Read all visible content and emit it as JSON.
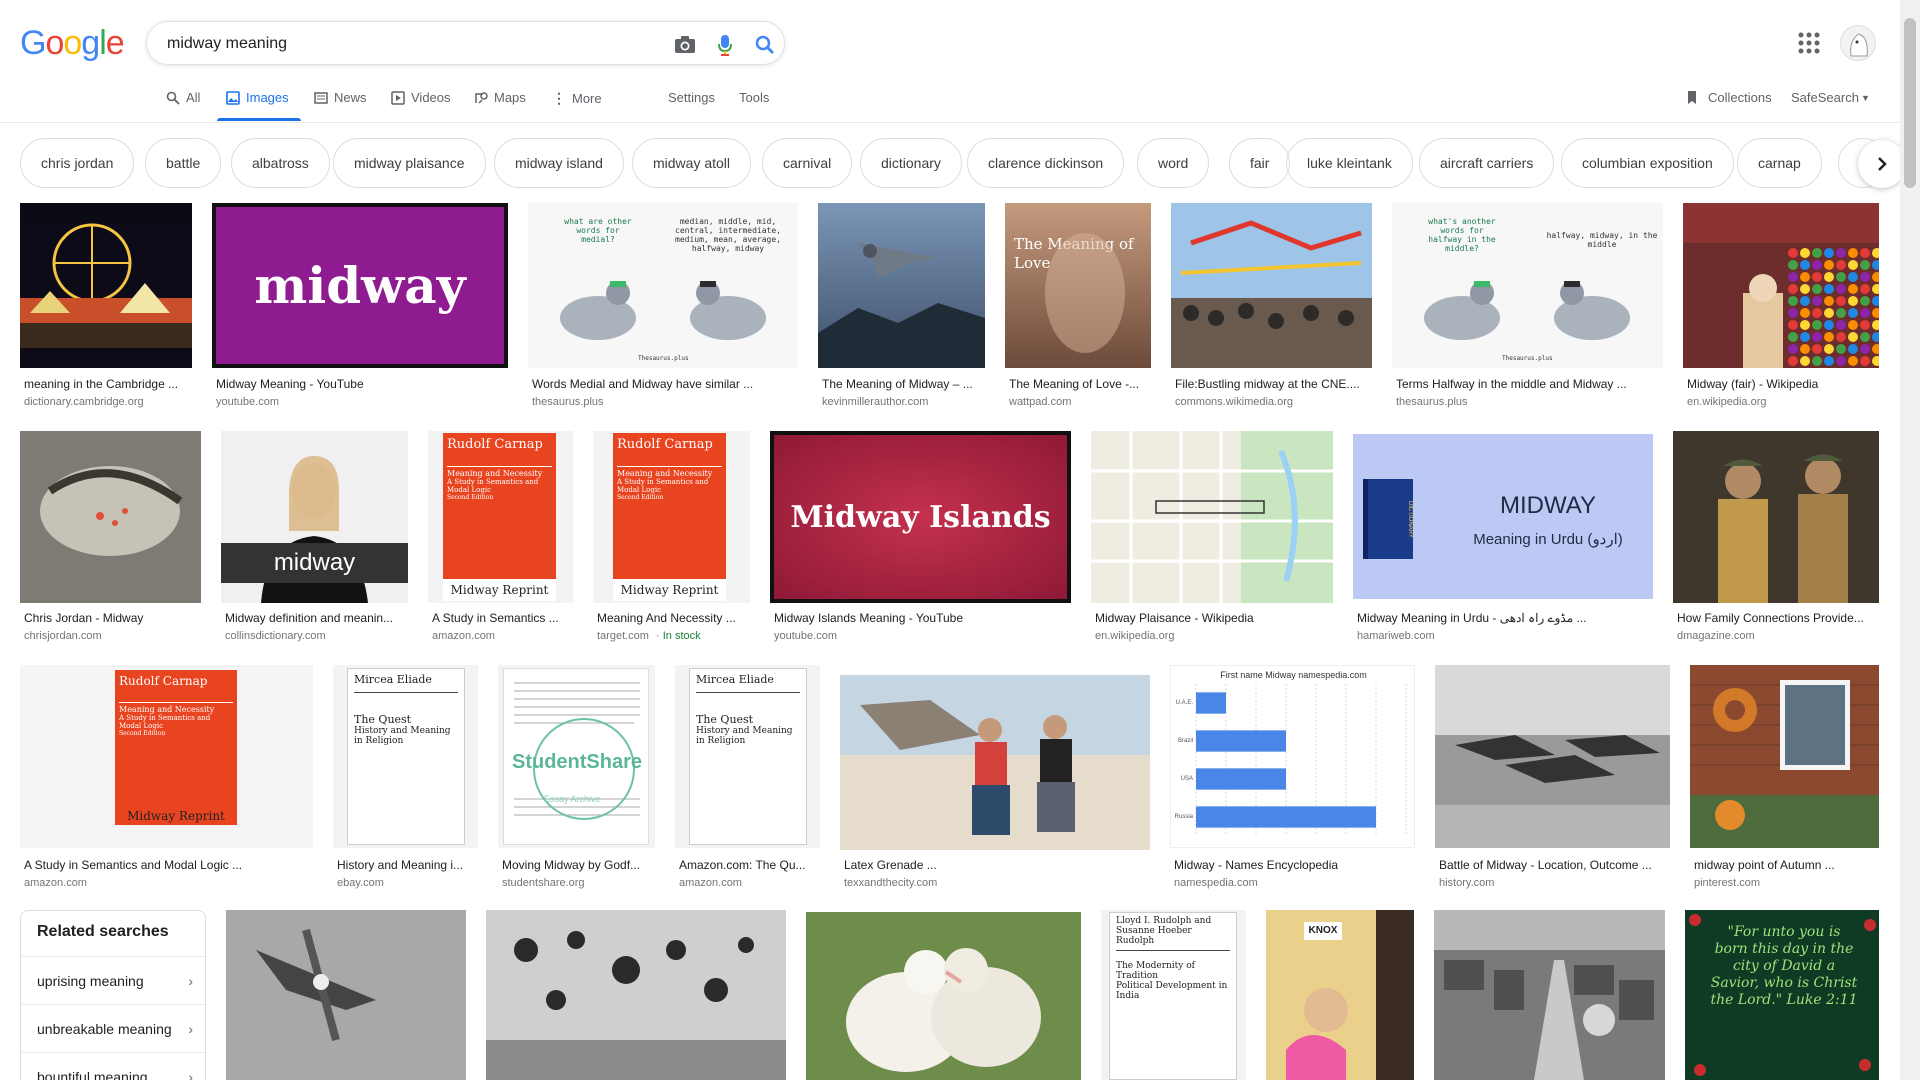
{
  "header": {
    "logo_letters": [
      "G",
      "o",
      "o",
      "g",
      "l",
      "e"
    ],
    "logo_colors": [
      "#4285f4",
      "#ea4335",
      "#fbbc05",
      "#4285f4",
      "#34a853",
      "#ea4335"
    ],
    "search_value": "midway meaning",
    "icons": {
      "camera": "camera-icon",
      "mic": "microphone-icon",
      "search": "search-icon",
      "apps": "apps-grid-icon"
    }
  },
  "tabs": {
    "all": "All",
    "images": "Images",
    "news": "News",
    "videos": "Videos",
    "maps": "Maps",
    "more": "More",
    "settings": "Settings",
    "tools": "Tools",
    "collections": "Collections",
    "safesearch": "SafeSearch"
  },
  "chips": [
    "chris jordan",
    "battle",
    "albatross",
    "midway plaisance",
    "midway island",
    "midway atoll",
    "carnival",
    "dictionary",
    "clarence dickinson",
    "word",
    "fair",
    "luke kleintank",
    "aircraft carriers",
    "columbian exposition",
    "carnap",
    "e"
  ],
  "results": {
    "row1": [
      {
        "caption": "meaning in the Cambridge ...",
        "source": "dictionary.cambridge.org"
      },
      {
        "caption": "Midway Meaning - YouTube",
        "source": "youtube.com",
        "image_text": "midway"
      },
      {
        "caption": "Words Medial and Midway have similar ...",
        "source": "thesaurus.plus",
        "image_text_left": "what are other words for medial?",
        "image_text_right": "median, middle, mid, central, intermediate, medium, mean, average, halfway, midway",
        "image_footer": "Thesaurus.plus"
      },
      {
        "caption": "The Meaning of Midway – ...",
        "source": "kevinmillerauthor.com"
      },
      {
        "caption": "The Meaning of Love -...",
        "source": "wattpad.com",
        "image_text": "The Meaning of Love"
      },
      {
        "caption": "File:Bustling midway at the CNE....",
        "source": "commons.wikimedia.org"
      },
      {
        "caption": "Terms Halfway in the middle and Midway ...",
        "source": "thesaurus.plus",
        "image_text_left": "what's another words for halfway in the middle?",
        "image_text_right": "halfway, midway, in the middle",
        "image_footer": "Thesaurus.plus"
      },
      {
        "caption": "Midway (fair) - Wikipedia",
        "source": "en.wikipedia.org"
      }
    ],
    "row2": [
      {
        "caption": "Chris Jordan - Midway",
        "source": "chrisjordan.com"
      },
      {
        "caption": "Midway definition and meanin...",
        "source": "collinsdictionary.com",
        "image_text": "midway"
      },
      {
        "caption": "A Study in Semantics ...",
        "source": "amazon.com",
        "image_author": "Rudolf Carnap",
        "image_title": "Meaning and Necessity",
        "image_sub": "A Study in Semantics and Modal Logic",
        "image_ed": "Second Edition",
        "image_footer": "Midway Reprint"
      },
      {
        "caption": "Meaning And Necessity ...",
        "source": "target.com",
        "stock": "In stock",
        "image_author": "Rudolf Carnap",
        "image_title": "Meaning and Necessity",
        "image_sub": "A Study in Semantics and Modal Logic",
        "image_ed": "Second Edition",
        "image_footer": "Midway Reprint"
      },
      {
        "caption": "Midway Islands Meaning - YouTube",
        "source": "youtube.com",
        "image_text": "Midway Islands"
      },
      {
        "caption": "Midway Plaisance - Wikipedia",
        "source": "en.wikipedia.org"
      },
      {
        "caption": "Midway Meaning in Urdu - مڈوے راہ ادھی ...",
        "source": "hamariweb.com",
        "image_title": "MIDWAY",
        "image_sub": "Meaning in Urdu (اردو)",
        "image_book": "DICTIONARY"
      },
      {
        "caption": "How Family Connections Provide...",
        "source": "dmagazine.com"
      }
    ],
    "row3": [
      {
        "caption": "A Study in Semantics and Modal Logic ...",
        "source": "amazon.com",
        "image_author": "Rudolf Carnap",
        "image_title": "Meaning and Necessity",
        "image_sub": "A Study in Semantics and Modal Logic",
        "image_ed": "Second Edition",
        "image_footer": "Midway Reprint"
      },
      {
        "caption": "History and Meaning i...",
        "source": "ebay.com",
        "image_author": "Mircea Eliade",
        "image_title": "The Quest",
        "image_sub": "History and Meaning in Religion"
      },
      {
        "caption": "Moving Midway by Godf...",
        "source": "studentshare.org",
        "image_text": "StudentShare",
        "image_sub": "Essay Archive"
      },
      {
        "caption": "Amazon.com: The Qu...",
        "source": "amazon.com",
        "image_author": "Mircea Eliade",
        "image_title": "The Quest",
        "image_sub": "History and Meaning in Religion"
      },
      {
        "caption": "Latex Grenade ...",
        "source": "texxandthecity.com"
      },
      {
        "caption": "Midway - Names Encyclopedia",
        "source": "namespedia.com",
        "image_title": "First name Midway namespedia.com"
      },
      {
        "caption": "Battle of Midway - Location, Outcome ...",
        "source": "history.com"
      },
      {
        "caption": "midway point of Autumn ...",
        "source": "pinterest.com"
      }
    ],
    "row4": [
      {
        "image_text": ""
      },
      {
        "image_text": ""
      },
      {
        "image_text": ""
      },
      {
        "image_author": "Lloyd I. Rudolph and Susanne Hoeber Rudolph",
        "image_title": "The Modernity of Tradition",
        "image_sub": "Political Development in India"
      },
      {
        "image_text": "KNOX"
      },
      {
        "image_text": ""
      },
      {
        "image_text": "\"For unto you is born this day in the city of David a Savior, who is Christ the Lord.\" Luke 2:11"
      }
    ]
  },
  "namespedia_chart": {
    "chart_data": {
      "type": "bar",
      "title": "First name Midway namespedia.com",
      "categories": [
        "U.A.E.",
        "Brazil",
        "USA",
        "Russia"
      ],
      "values": [
        1,
        3,
        3,
        6
      ],
      "xlim": [
        0,
        7
      ]
    }
  },
  "related": {
    "title": "Related searches",
    "items": [
      "uprising meaning",
      "unbreakable meaning",
      "bountiful meaning"
    ]
  }
}
